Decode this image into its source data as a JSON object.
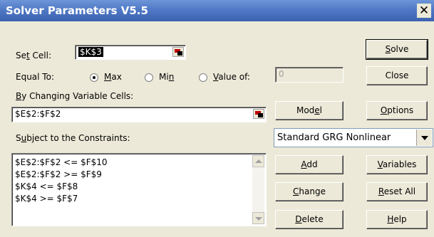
{
  "window": {
    "title": "Solver Parameters V5.5",
    "close_glyph": "✕"
  },
  "set_cell": {
    "label_pre": "Se",
    "label_key": "t",
    "label_post": " Cell:",
    "value": "$K$3"
  },
  "equal_to": {
    "label": "Equal To:",
    "options": [
      {
        "pre": "",
        "key": "M",
        "post": "ax",
        "selected": true
      },
      {
        "pre": "Mi",
        "key": "n",
        "post": "",
        "selected": false
      },
      {
        "pre": "",
        "key": "V",
        "post": "alue of:",
        "selected": false
      }
    ],
    "value_of": "0"
  },
  "changing_cells": {
    "label_pre": "",
    "label_key": "B",
    "label_post": "y Changing Variable Cells:",
    "value": "$E$2:$F$2"
  },
  "constraints": {
    "label_pre": "S",
    "label_key": "u",
    "label_post": "bject to the Constraints:",
    "items": [
      "$E$2:$F$2 <= $F$10",
      "$E$2:$F$2 >= $F$9",
      "$K$4 <= $F$8",
      "$K$4 >= $F$7"
    ]
  },
  "engine": {
    "selected": "Standard GRG Nonlinear"
  },
  "buttons": {
    "solve": {
      "pre": "",
      "key": "S",
      "post": "olve"
    },
    "close": {
      "pre": "Close",
      "key": "",
      "post": ""
    },
    "model": {
      "pre": "Mod",
      "key": "e",
      "post": "l"
    },
    "options": {
      "pre": "",
      "key": "O",
      "post": "ptions"
    },
    "add": {
      "pre": "",
      "key": "A",
      "post": "dd"
    },
    "variables": {
      "pre": "",
      "key": "V",
      "post": "ariables"
    },
    "change": {
      "pre": "",
      "key": "C",
      "post": "hange"
    },
    "reset_all": {
      "pre": "",
      "key": "R",
      "post": "eset All"
    },
    "delete": {
      "pre": "",
      "key": "D",
      "post": "elete"
    },
    "help": {
      "pre": "",
      "key": "H",
      "post": "elp"
    }
  },
  "icons": {
    "ref_button": "range-select-icon"
  }
}
